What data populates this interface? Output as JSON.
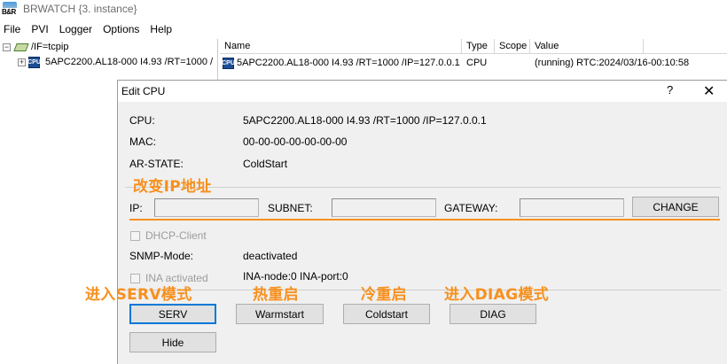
{
  "app": {
    "title": "BRWATCH {3. instance}",
    "logo_text": "B&R"
  },
  "menu": [
    "File",
    "PVI",
    "Logger",
    "Options",
    "Help"
  ],
  "tree": {
    "root_expander": "−",
    "root_label": "/IF=tcpip",
    "child_expander": "+",
    "child_label": "5APC2200.AL18-000 I4.93 /RT=1000 /"
  },
  "list": {
    "columns": [
      "Name",
      "Type",
      "Scope",
      "Value"
    ],
    "rows": [
      {
        "name": "5APC2200.AL18-000 I4.93 /RT=1000 /IP=127.0.0.1",
        "type": "CPU",
        "scope": "",
        "value": "(running) RTC:2024/03/16-00:10:58"
      }
    ]
  },
  "dialog": {
    "title": "Edit CPU",
    "help_glyph": "?",
    "close_glyph": "✕",
    "cpu_label": "CPU:",
    "cpu_value": "5APC2200.AL18-000 I4.93 /RT=1000 /IP=127.0.0.1",
    "mac_label": "MAC:",
    "mac_value": "00-00-00-00-00-00-00",
    "arstate_label": "AR-STATE:",
    "arstate_value": "ColdStart",
    "ip_label": "IP:",
    "ip_value": "",
    "subnet_label": "SUBNET:",
    "subnet_value": "",
    "gateway_label": "GATEWAY:",
    "gateway_value": "",
    "change_button": "CHANGE",
    "dhcp_label": "DHCP-Client",
    "snmp_label": "SNMP-Mode:",
    "snmp_value": "deactivated",
    "ina_label": "INA activated",
    "ina_value": "INA-node:0  INA-port:0",
    "serv_button": "SERV",
    "warmstart_button": "Warmstart",
    "coldstart_button": "Coldstart",
    "diag_button": "DIAG",
    "hide_button": "Hide"
  },
  "annotations": {
    "change_ip": "改变IP地址",
    "enter_serv": "进入SERV模式",
    "warm_restart": "热重启",
    "cold_restart": "冷重启",
    "enter_diag": "进入DIAG模式"
  },
  "colors": {
    "annotation": "#f7901e",
    "default_button_border": "#0078d7"
  }
}
